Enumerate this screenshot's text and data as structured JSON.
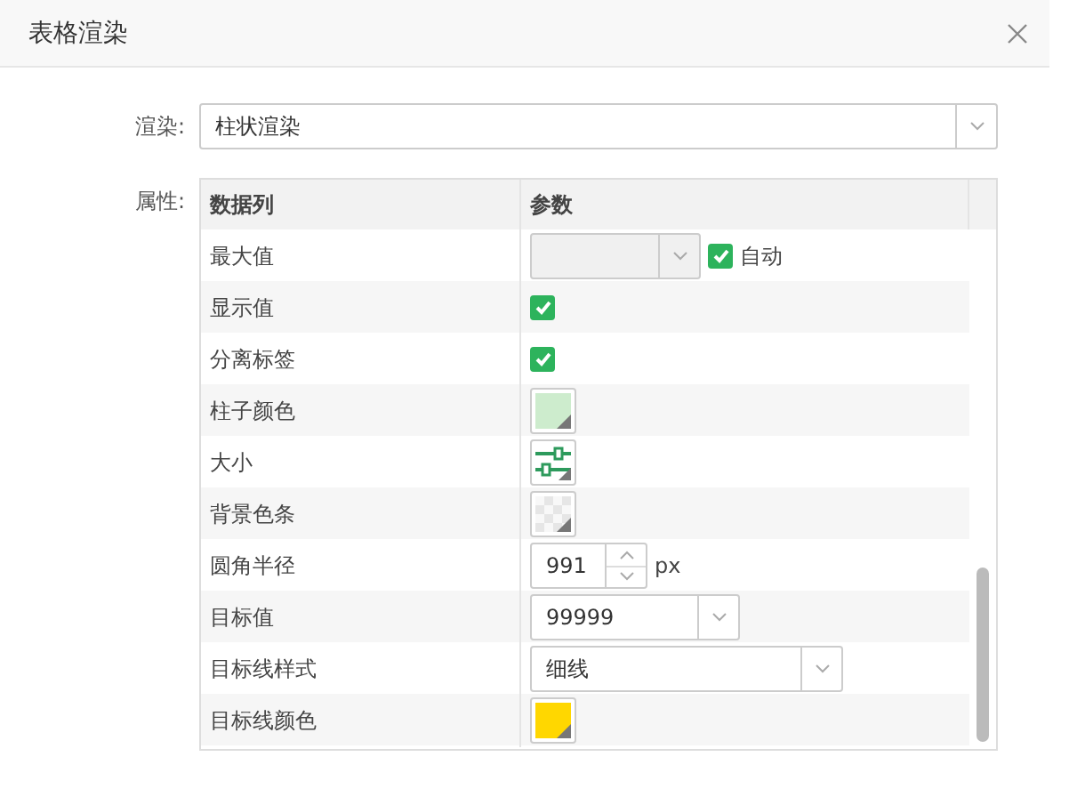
{
  "dialog": {
    "title": "表格渲染"
  },
  "render": {
    "label": "渲染:",
    "value": "柱状渲染"
  },
  "properties": {
    "label": "属性:",
    "columns": [
      "数据列",
      "参数"
    ],
    "rows": [
      {
        "name": "最大值",
        "kind": "auto-select",
        "disabled": true,
        "checkbox": {
          "label": "自动",
          "checked": true
        }
      },
      {
        "name": "显示值",
        "kind": "checkbox",
        "checked": true
      },
      {
        "name": "分离标签",
        "kind": "checkbox",
        "checked": true
      },
      {
        "name": "柱子颜色",
        "kind": "color",
        "color": "#cdeccd"
      },
      {
        "name": "大小",
        "kind": "size"
      },
      {
        "name": "背景色条",
        "kind": "transparent"
      },
      {
        "name": "圆角半径",
        "kind": "spinner",
        "value": "991",
        "unit": "px"
      },
      {
        "name": "目标值",
        "kind": "combo",
        "value": "99999"
      },
      {
        "name": "目标线样式",
        "kind": "select",
        "value": "细线"
      },
      {
        "name": "目标线颜色",
        "kind": "color",
        "color": "#ffd700"
      }
    ]
  }
}
